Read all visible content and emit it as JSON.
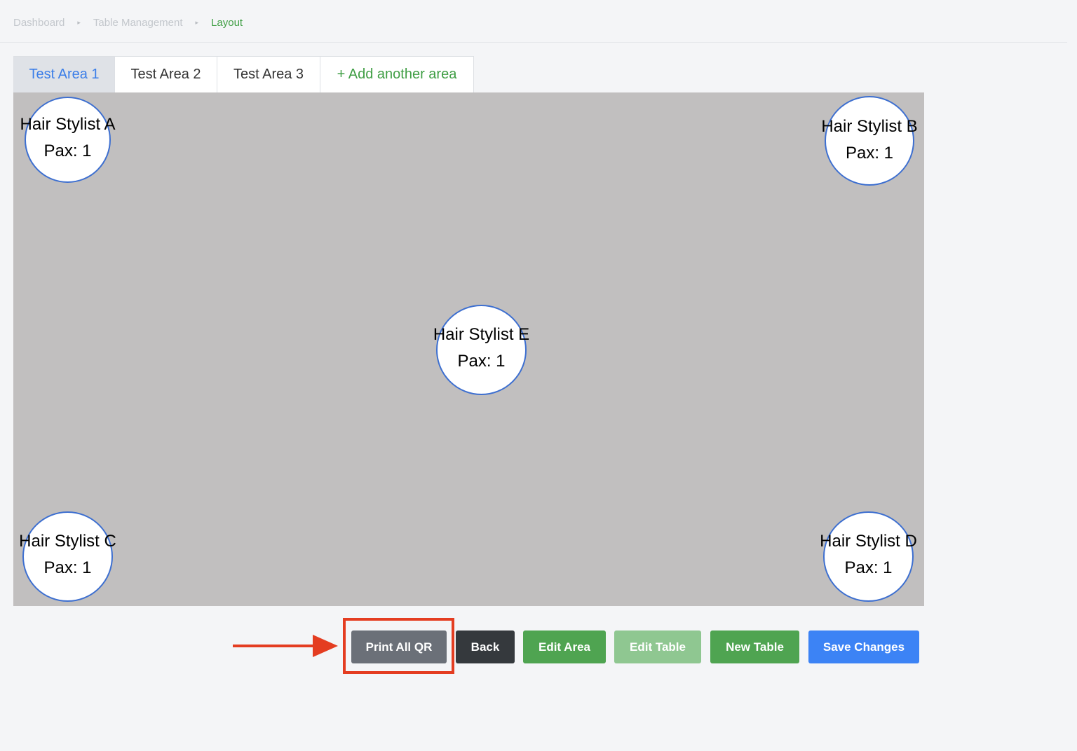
{
  "breadcrumb": {
    "items": [
      "Dashboard",
      "Table Management",
      "Layout"
    ],
    "separator": "▸"
  },
  "tabs": [
    {
      "label": "Test Area 1",
      "active": true
    },
    {
      "label": "Test Area 2",
      "active": false
    },
    {
      "label": "Test Area 3",
      "active": false
    },
    {
      "label": "+ Add another area",
      "active": false
    }
  ],
  "tables": [
    {
      "name": "Hair Stylist A",
      "pax": "Pax: 1"
    },
    {
      "name": "Hair Stylist B",
      "pax": "Pax: 1"
    },
    {
      "name": "Hair Stylist E",
      "pax": "Pax: 1"
    },
    {
      "name": "Hair Stylist C",
      "pax": "Pax: 1"
    },
    {
      "name": "Hair Stylist D",
      "pax": "Pax: 1"
    }
  ],
  "actions": {
    "print_all_qr": "Print All QR",
    "back": "Back",
    "edit_area": "Edit Area",
    "edit_table": "Edit Table",
    "new_table": "New Table",
    "save_changes": "Save Changes"
  },
  "colors": {
    "accent_blue": "#3c83f5",
    "accent_green": "#4fa451",
    "highlight_red": "#e43d21",
    "canvas_gray": "#c1bfbf"
  },
  "annotations": {
    "highlighted_element": "print-all-qr-button",
    "pointer_icon": "arrow-right-icon"
  }
}
